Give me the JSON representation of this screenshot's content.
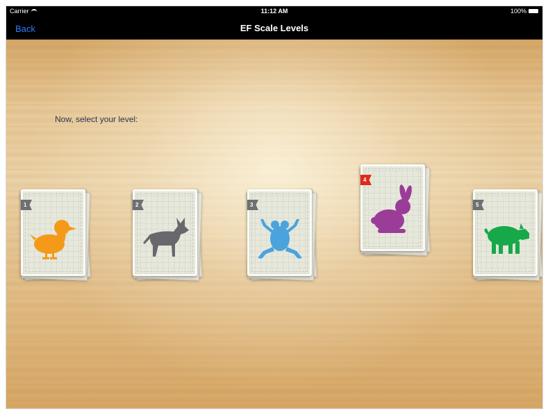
{
  "status_bar": {
    "carrier": "Carrier",
    "time": "11:12 AM",
    "battery": "100%"
  },
  "nav": {
    "back_label": "Back",
    "title": "EF Scale Levels"
  },
  "prompt": "Now, select your level:",
  "levels": [
    {
      "number": "1",
      "animal": "duck-icon",
      "color": "#f49a18"
    },
    {
      "number": "2",
      "animal": "dog-icon",
      "color": "#66686b"
    },
    {
      "number": "3",
      "animal": "frog-icon",
      "color": "#4aa3dd"
    },
    {
      "number": "4",
      "animal": "rabbit-icon",
      "color": "#9a3c98",
      "selected": true
    },
    {
      "number": "5",
      "animal": "pig-icon",
      "color": "#17a84a"
    }
  ],
  "colors": {
    "flag_default": "#6d6f72",
    "flag_selected": "#e02b18",
    "back_link": "#2f7cf6"
  }
}
